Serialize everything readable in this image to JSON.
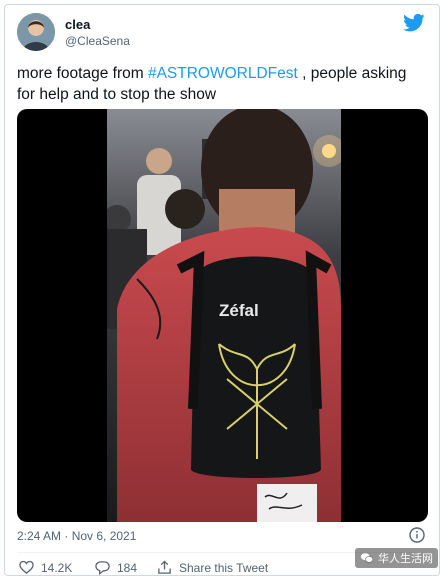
{
  "author": {
    "display_name": "clea",
    "handle": "@CleaSena"
  },
  "tweet": {
    "text_before": "more footage from ",
    "hashtag": "#ASTROWORLDFest",
    "text_after": " , people asking for help and to stop the show"
  },
  "media": {
    "overlay_text": "Zéfal"
  },
  "meta": {
    "timestamp": "2:24 AM · Nov 6, 2021"
  },
  "actions": {
    "likes": "14.2K",
    "replies": "184",
    "share_label": "Share this Tweet"
  },
  "watermark": {
    "text": "华人生活网"
  },
  "colors": {
    "accent": "#1d9bf0",
    "text": "#0f1419",
    "secondary": "#536471",
    "border": "#cfd9de"
  },
  "icons": {
    "brand": "twitter-bird-icon",
    "info": "info-icon",
    "like": "heart-icon",
    "reply": "reply-icon",
    "share": "share-icon"
  }
}
